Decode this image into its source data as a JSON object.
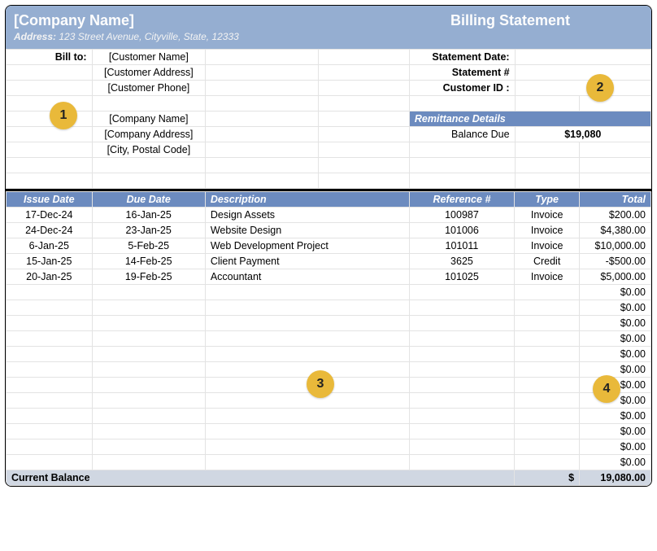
{
  "header": {
    "company_name": "[Company Name]",
    "address_label": "Address:",
    "address_value": "123 Street Avenue, Cityville, State, 12333",
    "title": "Billing Statement"
  },
  "bill_to": {
    "label": "Bill to:",
    "lines": [
      "[Customer Name]",
      "[Customer Address]",
      "[Customer Phone]"
    ]
  },
  "from": {
    "lines": [
      "[Company Name]",
      "[Company Address]",
      "[City, Postal Code]"
    ]
  },
  "statement_meta": {
    "date_label": "Statement Date:",
    "date_value": "",
    "number_label": "Statement #",
    "number_value": "",
    "customer_id_label": "Customer ID :",
    "customer_id_value": ""
  },
  "remittance": {
    "header": "Remittance Details",
    "balance_due_label": "Balance Due",
    "balance_due_value": "$19,080"
  },
  "columns": {
    "issue_date": "Issue Date",
    "due_date": "Due Date",
    "description": "Description",
    "reference": "Reference #",
    "type": "Type",
    "total": "Total"
  },
  "items": [
    {
      "issue_date": "17-Dec-24",
      "due_date": "16-Jan-25",
      "description": "Design Assets",
      "reference": "100987",
      "type": "Invoice",
      "total": "$200.00"
    },
    {
      "issue_date": "24-Dec-24",
      "due_date": "23-Jan-25",
      "description": "Website Design",
      "reference": "101006",
      "type": "Invoice",
      "total": "$4,380.00"
    },
    {
      "issue_date": "6-Jan-25",
      "due_date": "5-Feb-25",
      "description": "Web Development Project",
      "reference": "101011",
      "type": "Invoice",
      "total": "$10,000.00"
    },
    {
      "issue_date": "15-Jan-25",
      "due_date": "14-Feb-25",
      "description": "Client Payment",
      "reference": "3625",
      "type": "Credit",
      "total": "-$500.00"
    },
    {
      "issue_date": "20-Jan-25",
      "due_date": "19-Feb-25",
      "description": "Accountant",
      "reference": "101025",
      "type": "Invoice",
      "total": "$5,000.00"
    },
    {
      "issue_date": "",
      "due_date": "",
      "description": "",
      "reference": "",
      "type": "",
      "total": "$0.00"
    },
    {
      "issue_date": "",
      "due_date": "",
      "description": "",
      "reference": "",
      "type": "",
      "total": "$0.00"
    },
    {
      "issue_date": "",
      "due_date": "",
      "description": "",
      "reference": "",
      "type": "",
      "total": "$0.00"
    },
    {
      "issue_date": "",
      "due_date": "",
      "description": "",
      "reference": "",
      "type": "",
      "total": "$0.00"
    },
    {
      "issue_date": "",
      "due_date": "",
      "description": "",
      "reference": "",
      "type": "",
      "total": "$0.00"
    },
    {
      "issue_date": "",
      "due_date": "",
      "description": "",
      "reference": "",
      "type": "",
      "total": "$0.00"
    },
    {
      "issue_date": "",
      "due_date": "",
      "description": "",
      "reference": "",
      "type": "",
      "total": "$0.00"
    },
    {
      "issue_date": "",
      "due_date": "",
      "description": "",
      "reference": "",
      "type": "",
      "total": "$0.00"
    },
    {
      "issue_date": "",
      "due_date": "",
      "description": "",
      "reference": "",
      "type": "",
      "total": "$0.00"
    },
    {
      "issue_date": "",
      "due_date": "",
      "description": "",
      "reference": "",
      "type": "",
      "total": "$0.00"
    },
    {
      "issue_date": "",
      "due_date": "",
      "description": "",
      "reference": "",
      "type": "",
      "total": "$0.00"
    },
    {
      "issue_date": "",
      "due_date": "",
      "description": "",
      "reference": "",
      "type": "",
      "total": "$0.00"
    }
  ],
  "footer": {
    "label": "Current Balance",
    "currency": "$",
    "amount": "19,080.00"
  },
  "callouts": {
    "c1": "1",
    "c2": "2",
    "c3": "3",
    "c4": "4"
  }
}
